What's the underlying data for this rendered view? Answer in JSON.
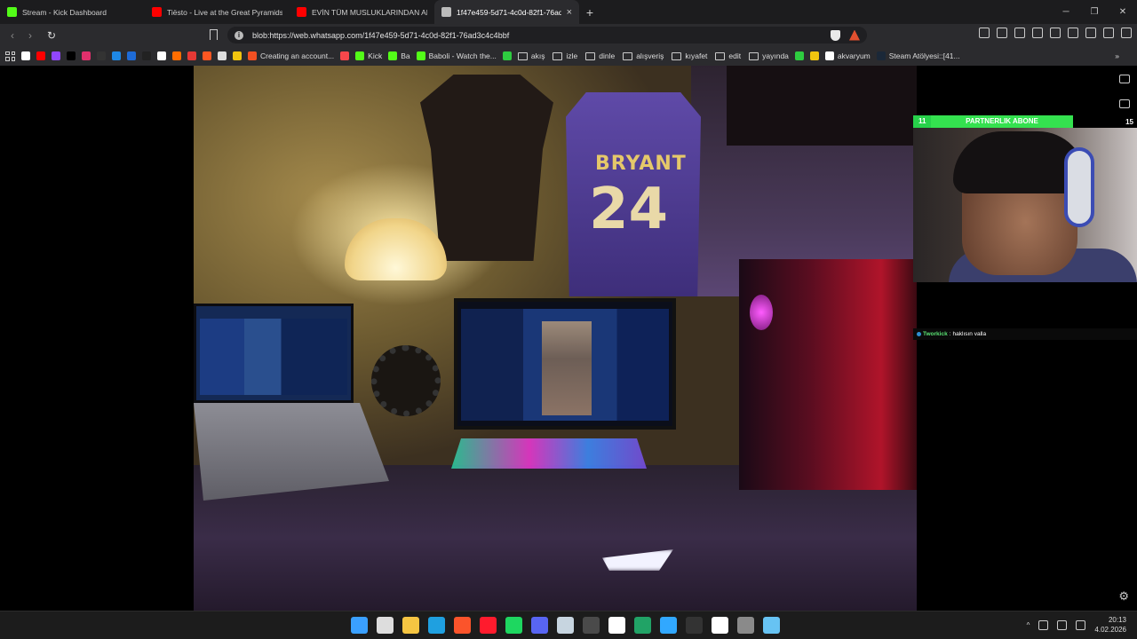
{
  "tabs": [
    {
      "title": "Stream - Kick Dashboard",
      "color": "#53fc18",
      "active": false
    },
    {
      "title": "Tiësto - Live at the Great Pyramids of",
      "color": "#ff0000",
      "active": false
    },
    {
      "title": "EVİN TÜM MUSLUKLARINDAN ALKO",
      "color": "#ff0000",
      "active": false
    },
    {
      "title": "1f47e459-5d71-4c0d-82f1-76ad",
      "color": "#bbbbbb",
      "active": true
    }
  ],
  "tab_close": "×",
  "new_tab": "+",
  "window_controls": {
    "minimize": "─",
    "maximize": "❐",
    "close": "✕"
  },
  "nav": {
    "back": "‹",
    "forward": "›",
    "reload": "↻"
  },
  "address": {
    "url": "blob:https://web.whatsapp.com/1f47e459-5d71-4c0d-82f1-76ad3c4c4bbf",
    "info_icon": "i"
  },
  "bookmarks": [
    {
      "label": "",
      "color": "#ffffff"
    },
    {
      "label": "",
      "color": "#ff0000"
    },
    {
      "label": "",
      "color": "#9146ff"
    },
    {
      "label": "",
      "color": "#000000"
    },
    {
      "label": "",
      "color": "#e1306c"
    },
    {
      "label": "",
      "color": "#333333"
    },
    {
      "label": "",
      "color": "#1e88e5"
    },
    {
      "label": "",
      "color": "#1e6bd6"
    },
    {
      "label": "",
      "color": "#222222"
    },
    {
      "label": "",
      "color": "#ffffff"
    },
    {
      "label": "",
      "color": "#ff6d00"
    },
    {
      "label": "",
      "color": "#e53935"
    },
    {
      "label": "",
      "color": "#ff5722"
    },
    {
      "label": "",
      "color": "#dddddd"
    },
    {
      "label": "",
      "color": "#f1c40f"
    },
    {
      "label": "Creating an account...",
      "color": "#f25022"
    },
    {
      "label": "",
      "color": "#f7474b"
    },
    {
      "label": "Kick",
      "color": "#53fc18"
    },
    {
      "label": "Ba",
      "color": "#53fc18"
    },
    {
      "label": "Baboli - Watch the...",
      "color": "#53fc18"
    },
    {
      "label": "",
      "color": "#2ecc40"
    }
  ],
  "bookmark_folders": [
    "akış",
    "izle",
    "dinle",
    "alışveriş",
    "kıyafet",
    "edit",
    "yayında"
  ],
  "bookmarks_tail": [
    {
      "label": "",
      "color": "#2ecc40"
    },
    {
      "label": "",
      "color": "#f1c40f"
    },
    {
      "label": "akvaryum",
      "color": "#ffffff"
    },
    {
      "label": "Steam Atölyesi::[41...",
      "color": "#1b2838"
    }
  ],
  "bookmarks_more": "»",
  "photo": {
    "jersey_name": "BRYANT",
    "jersey_number": "24"
  },
  "overlay": {
    "left_count": "11",
    "label": "PARTNERLIK ABONE",
    "right_count": "15",
    "accent": "#34e14f"
  },
  "chat": {
    "user": "Tworkick",
    "separator": ":",
    "message": "haklısın valla"
  },
  "taskbar": {
    "apps": [
      "windows",
      "search",
      "files",
      "edge",
      "brave",
      "opera",
      "spotify",
      "discord",
      "steam",
      "calculator",
      "capcut",
      "excel",
      "photoshop",
      "obs",
      "paint",
      "settings",
      "notepad"
    ],
    "tray": {
      "caret": "^",
      "time": "20:13",
      "date": "4.02.2026"
    }
  }
}
